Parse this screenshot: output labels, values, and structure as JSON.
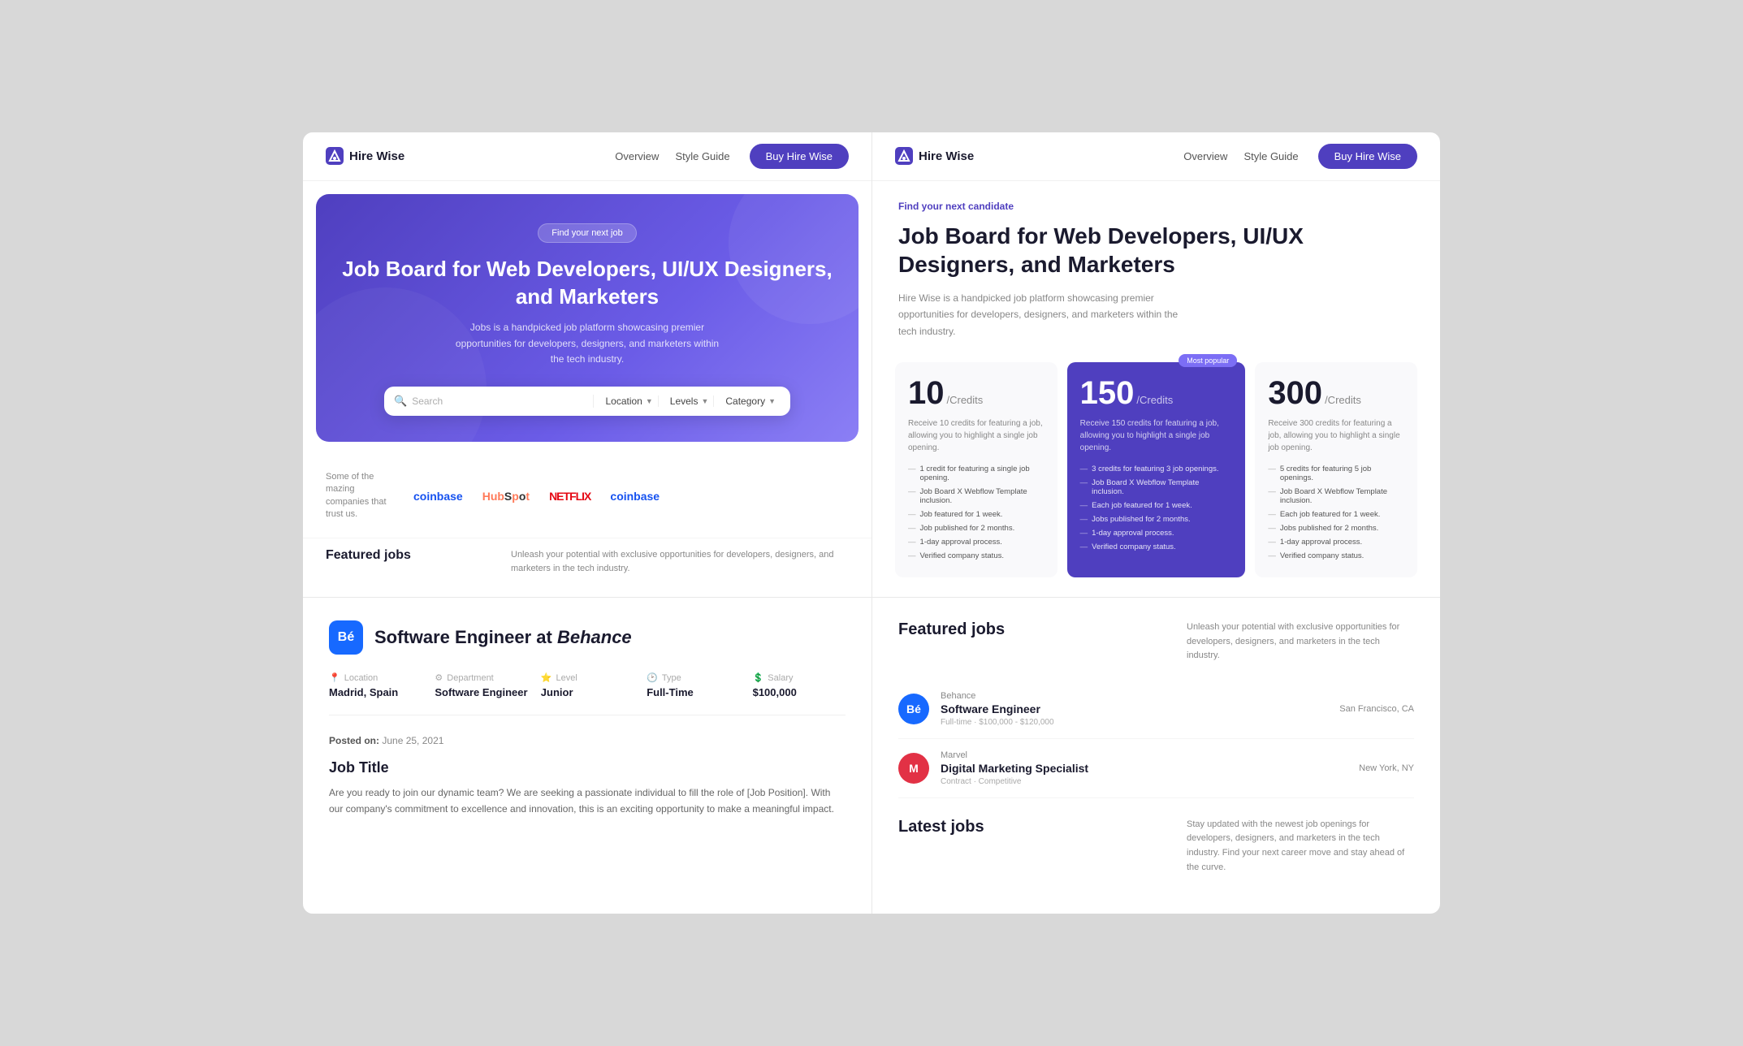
{
  "nav": {
    "logo_text": "Hire Wise",
    "overview_label": "Overview",
    "style_guide_label": "Style Guide",
    "buy_button_label": "Buy Hire Wise"
  },
  "hero": {
    "badge": "Find your next job",
    "title": "Job Board for Web Developers, UI/UX Designers, and Marketers",
    "subtitle": "Jobs is a handpicked job platform showcasing premier opportunities for developers, designers, and marketers within the tech industry.",
    "search_placeholder": "Search",
    "location_label": "Location",
    "levels_label": "Levels",
    "category_label": "Category"
  },
  "trusted": {
    "label": "Some of the mazing companies that trust us.",
    "companies": [
      "Coinbase",
      "HubSpot",
      "NETFLIX",
      "Coinbase"
    ]
  },
  "featured_section": {
    "label": "Featured jobs",
    "description": "Unleash your potential with exclusive opportunities for developers, designers, and marketers in the tech industry."
  },
  "right_hero": {
    "find_badge": "Find your next candidate",
    "title": "Job Board for Web Developers, UI/UX Designers, and Marketers",
    "subtitle": "Hire Wise is a handpicked job platform showcasing premier opportunities for developers, designers, and marketers within the tech industry."
  },
  "pricing": {
    "cards": [
      {
        "credits": "10",
        "unit": "/Credits",
        "popular": false,
        "description": "Receive 10 credits for featuring a job, allowing you to highlight a single job opening.",
        "features": [
          "1 credit for featuring a single job opening.",
          "Job Board X Webflow Template inclusion.",
          "Job featured for 1 week.",
          "Job published for 2 months.",
          "1-day approval process.",
          "Verified company status."
        ]
      },
      {
        "credits": "150",
        "unit": "/Credits",
        "popular": true,
        "popular_label": "Most popular",
        "description": "Receive 150 credits for featuring a job, allowing you to highlight a single job opening.",
        "features": [
          "3 credits for featuring 3 job openings.",
          "Job Board X Webflow Template inclusion.",
          "Each job featured for 1 week.",
          "Jobs published for 2 months.",
          "1-day approval process.",
          "Verified company status."
        ]
      },
      {
        "credits": "300",
        "unit": "/Credits",
        "popular": false,
        "description": "Receive 300 credits for featuring a job, allowing you to highlight a single job opening.",
        "features": [
          "5 credits for featuring 5 job openings.",
          "Job Board X Webflow Template inclusion.",
          "Each job featured for 1 week.",
          "Jobs published for 2 months.",
          "1-day approval process.",
          "Verified company status."
        ]
      }
    ]
  },
  "job_detail": {
    "company": "Behance",
    "company_initial": "Bē",
    "title_prefix": "Software Engineer at",
    "company_italic": "Behance",
    "meta": {
      "location_label": "Location",
      "location_value": "Madrid, Spain",
      "department_label": "Department",
      "department_value": "Software Engineer",
      "level_label": "Level",
      "level_value": "Junior",
      "type_label": "Type",
      "type_value": "Full-Time",
      "salary_label": "Salary",
      "salary_value": "$100,000"
    },
    "posted_on": "June 25, 2021",
    "section_title": "Job Title",
    "body_text": "Are you ready to join our dynamic team? We are seeking a passionate individual to fill the role of [Job Position]. With our company's commitment to excellence and innovation, this is an exciting opportunity to make a meaningful impact."
  },
  "featured_jobs": {
    "title": "Featured jobs",
    "description": "Unleash your potential with exclusive opportunities for developers, designers, and marketers in the tech industry.",
    "jobs": [
      {
        "company": "Behance",
        "company_initial": "Bē",
        "avatar_class": "avatar-behance",
        "title": "Software Engineer",
        "tags": "Full-time  ·  $100,000 - $120,000",
        "location": "San Francisco, CA"
      },
      {
        "company": "Marvel",
        "company_initial": "M",
        "avatar_class": "avatar-marvel",
        "title": "Digital Marketing Specialist",
        "tags": "Contract  ·  Competitive",
        "location": "New York, NY"
      }
    ]
  },
  "latest_jobs": {
    "title": "Latest jobs",
    "description": "Stay updated with the newest job openings for developers, designers, and marketers in the tech industry. Find your next career move and stay ahead of the curve."
  }
}
